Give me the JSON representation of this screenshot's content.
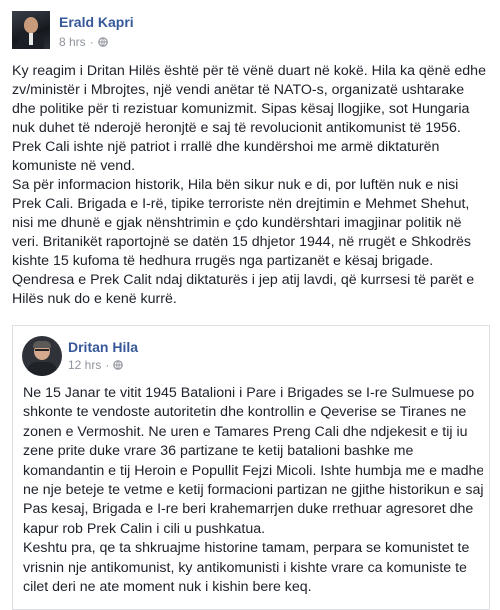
{
  "post": {
    "author": "Erald Kapri",
    "time": "8 hrs",
    "separator": "·",
    "privacy_icon": "globe-icon",
    "lines": [
      "Ky reagim i Dritan Hilës është për të vënë duart në kokë. Hila ka qënë edhe",
      "zv/ministër i Mbrojtes, një vendi anëtar të NATO-s, organizatë ushtarake",
      "dhe politike për ti rezistuar komunizmit. Sipas kësaj llogjike, sot Hungaria",
      "nuk duhet të nderojë heronjtë e saj të revolucionit antikomunist të 1956.",
      "Prek Cali ishte një patriot i rrallë dhe kundërshoi me armë diktaturën",
      "komuniste në vend.",
      "Sa për informacion historik, Hila bën sikur nuk e di, por luftën nuk e nisi",
      "Prek Cali. Brigada e I-rë, tipike terroriste nën drejtimin e Mehmet Shehut,",
      "nisi me dhunë e gjak nënshtrimin e çdo kundërshtari imagjinar politik në",
      "veri. Britanikët raportojnë se datën 15 dhjetor 1944, në rrugët e Shkodrës",
      "kishte 15 kufoma të hedhura rrugës nga partizanët e kësaj brigade.",
      "Qendresa e Prek Calit ndaj diktaturës i jep atij lavdi, që kurrsesi të parët e",
      "Hilës nuk do e kenë kurrë."
    ]
  },
  "shared": {
    "author": "Dritan Hila",
    "time": "12 hrs",
    "separator": "·",
    "privacy_icon": "globe-icon",
    "lines": [
      "Ne 15 Janar te vitit 1945 Batalioni i Pare i Brigades se I-re Sulmuese po",
      "shkonte te vendoste autoritetin dhe kontrollin e Qeverise se Tiranes ne",
      "zonen e Vermoshit. Ne uren e Tamares Preng Cali dhe ndjekesit e tij iu",
      "zene prite duke vrare 36 partizane te ketij batalioni bashke me",
      "komandantin e tij Heroin e Popullit Fejzi Micoli. Ishte humbja me e madhe",
      "ne nje beteje te vetme e ketij formacioni partizan ne gjithe historikun e saj.",
      "Pas kesaj, Brigada e I-re beri krahemarrjen duke rrethuar agresoret dhe",
      "kapur rob Prek Calin i cili u pushkatua.",
      "Keshtu pra, qe ta shkruajme historine tamam, perpara se komunistet te",
      "vrisnin nje antikomunist, ky antikomunisti i kishte vrare ca komuniste te",
      "cilet deri ne ate moment nuk i kishin bere keq."
    ]
  },
  "colors": {
    "link": "#365899",
    "text": "#1d2129",
    "meta": "#90949c",
    "border": "#dddfe2"
  }
}
